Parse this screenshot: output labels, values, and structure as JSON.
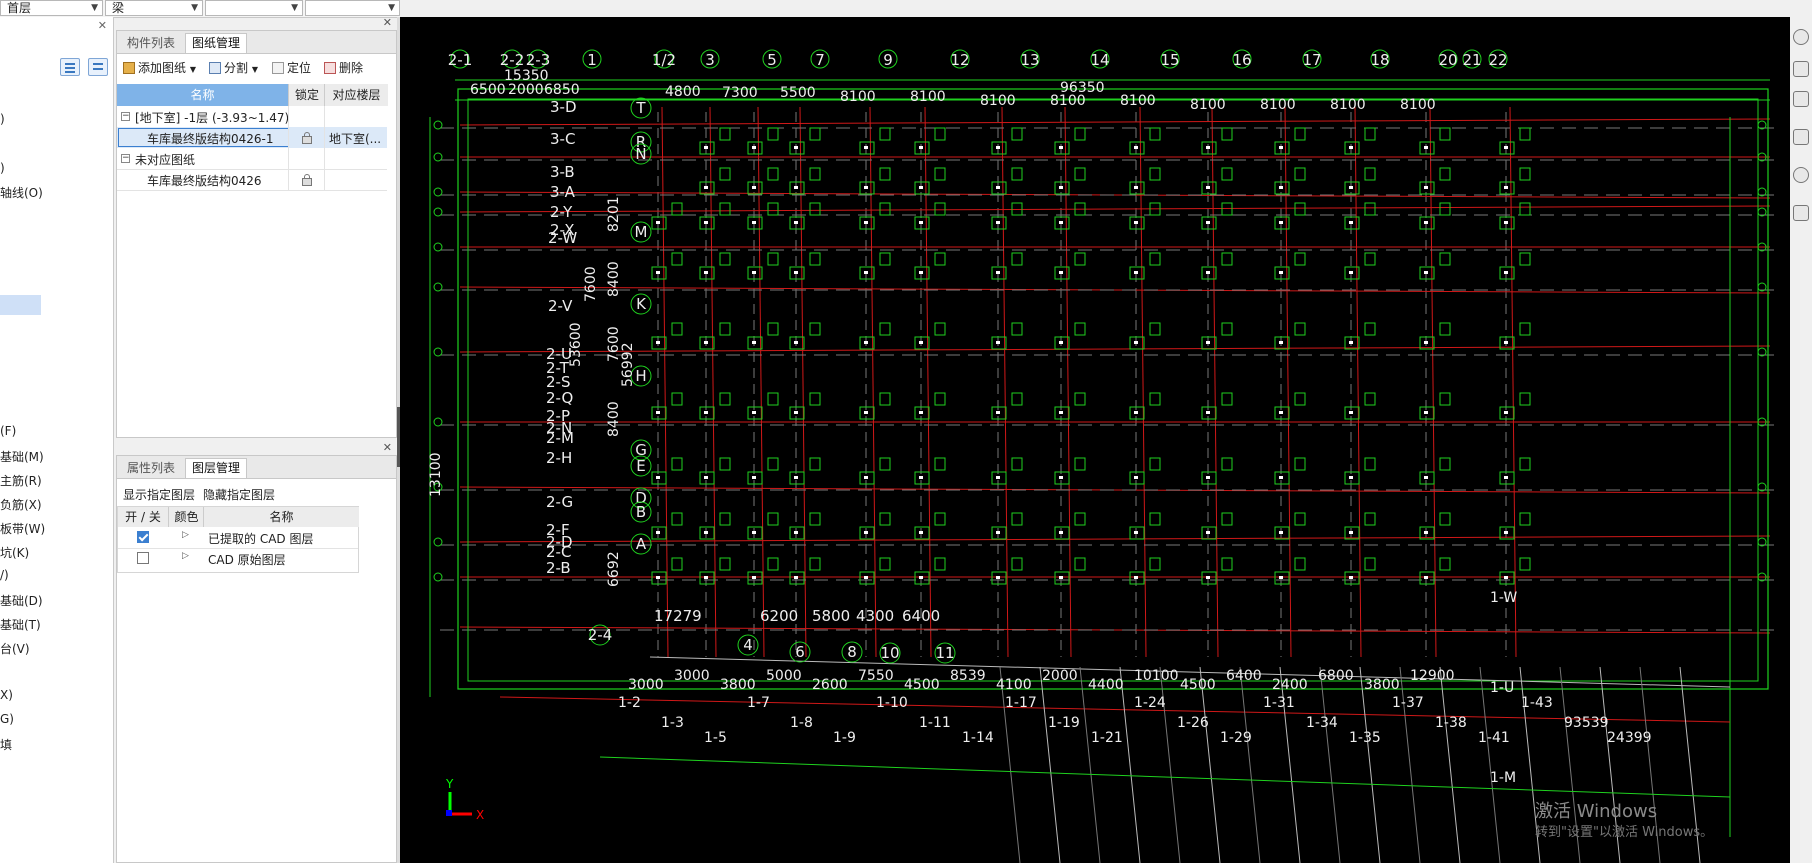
{
  "toolbar": {
    "floor_select": "首层",
    "category_select": "梁",
    "combo3": "",
    "combo4": ""
  },
  "left_strip": {
    "labels": [
      ")",
      ")",
      "轴线(O)",
      "(F)",
      "基础(M)",
      "主筋(R)",
      "负筋(X)",
      "板带(W)",
      "坑(K)",
      "/)",
      "基础(D)",
      "基础(T)",
      "台(V)",
      "X)",
      "G)",
      "填"
    ]
  },
  "drawing_panel": {
    "tabs": [
      "构件列表",
      "图纸管理"
    ],
    "active_tab": "图纸管理",
    "toolbar": {
      "add_label": "添加图纸",
      "split_label": "分割",
      "locate_label": "定位",
      "delete_label": "删除"
    },
    "columns": [
      "名称",
      "锁定",
      "对应楼层"
    ],
    "groups": [
      {
        "label": "[地下室] -1层 (-3.93~1.47)",
        "rows": [
          {
            "name": "车库最终版结构0426-1",
            "floor": "地下室(..."
          }
        ]
      },
      {
        "label": "未对应图纸",
        "rows": [
          {
            "name": "车库最终版结构0426",
            "floor": ""
          }
        ]
      }
    ]
  },
  "layer_panel": {
    "tabs": [
      "属性列表",
      "图层管理"
    ],
    "active_tab": "图层管理",
    "show_label": "显示指定图层",
    "hide_label": "隐藏指定图层",
    "columns": [
      "开 / 关",
      "颜色",
      "名称"
    ],
    "rows": [
      {
        "checked": true,
        "name": "已提取的 CAD 图层"
      },
      {
        "checked": false,
        "name": "CAD 原始图层"
      }
    ]
  },
  "cad": {
    "top_axes": [
      "2-1",
      "2-2",
      "2-3",
      "1",
      "1/2",
      "3",
      "5",
      "7",
      "9",
      "12",
      "13",
      "14",
      "15",
      "16",
      "17",
      "18",
      "20",
      "21",
      "22"
    ],
    "top_dims": [
      "6500",
      "2000",
      "6850",
      "15350",
      "4800",
      "7300",
      "5500",
      "8100",
      "8100",
      "8100",
      "8100",
      "8100",
      "8100",
      "8100",
      "8100",
      "8100",
      "96350"
    ],
    "left_axes": [
      "3-D",
      "3-C",
      "3-B",
      "3-A",
      "2-Y",
      "2-X",
      "2-W",
      "2-V",
      "2-U",
      "2-T",
      "2-S",
      "2-Q",
      "2-P",
      "2-N",
      "2-M",
      "2-H",
      "2-G",
      "2-F",
      "2-D",
      "2-C",
      "2-B"
    ],
    "row_axes": [
      "T",
      "R",
      "N",
      "M",
      "K",
      "H",
      "G",
      "E",
      "D",
      "B",
      "A"
    ],
    "vertical_dims": [
      "8201",
      "7600",
      "8400",
      "7600",
      "56992",
      "8400",
      "6692",
      "53600",
      "13100"
    ],
    "bottom_axes": [
      "2-4",
      "4",
      "6",
      "8",
      "10",
      "11"
    ],
    "bottom_dims": [
      "17279",
      "6200",
      "5800",
      "4300",
      "6400"
    ],
    "bottom_dims2": [
      "3000",
      "3000",
      "3800",
      "5000",
      "2600",
      "7550",
      "4500",
      "8539",
      "4100",
      "2000",
      "4400",
      "10100",
      "4500",
      "6400",
      "2400",
      "6800",
      "3800",
      "12900"
    ],
    "bottom_labels": [
      "1-2",
      "1-3",
      "1-5",
      "1-7",
      "1-8",
      "1-9",
      "1-10",
      "1-11",
      "1-14",
      "1-17",
      "1-19",
      "1-21",
      "1-24",
      "1-26",
      "1-29",
      "1-31",
      "1-34",
      "1-35",
      "1-37",
      "1-38",
      "1-41",
      "1-43",
      "93539",
      "24399"
    ],
    "right_labels": [
      "1-W",
      "1-U",
      "1-M"
    ],
    "axis_x_label": "X",
    "axis_y_label": "Y",
    "watermark_line1": "激活 Windows",
    "watermark_line2": "转到\"设置\"以激活 Windows。"
  }
}
